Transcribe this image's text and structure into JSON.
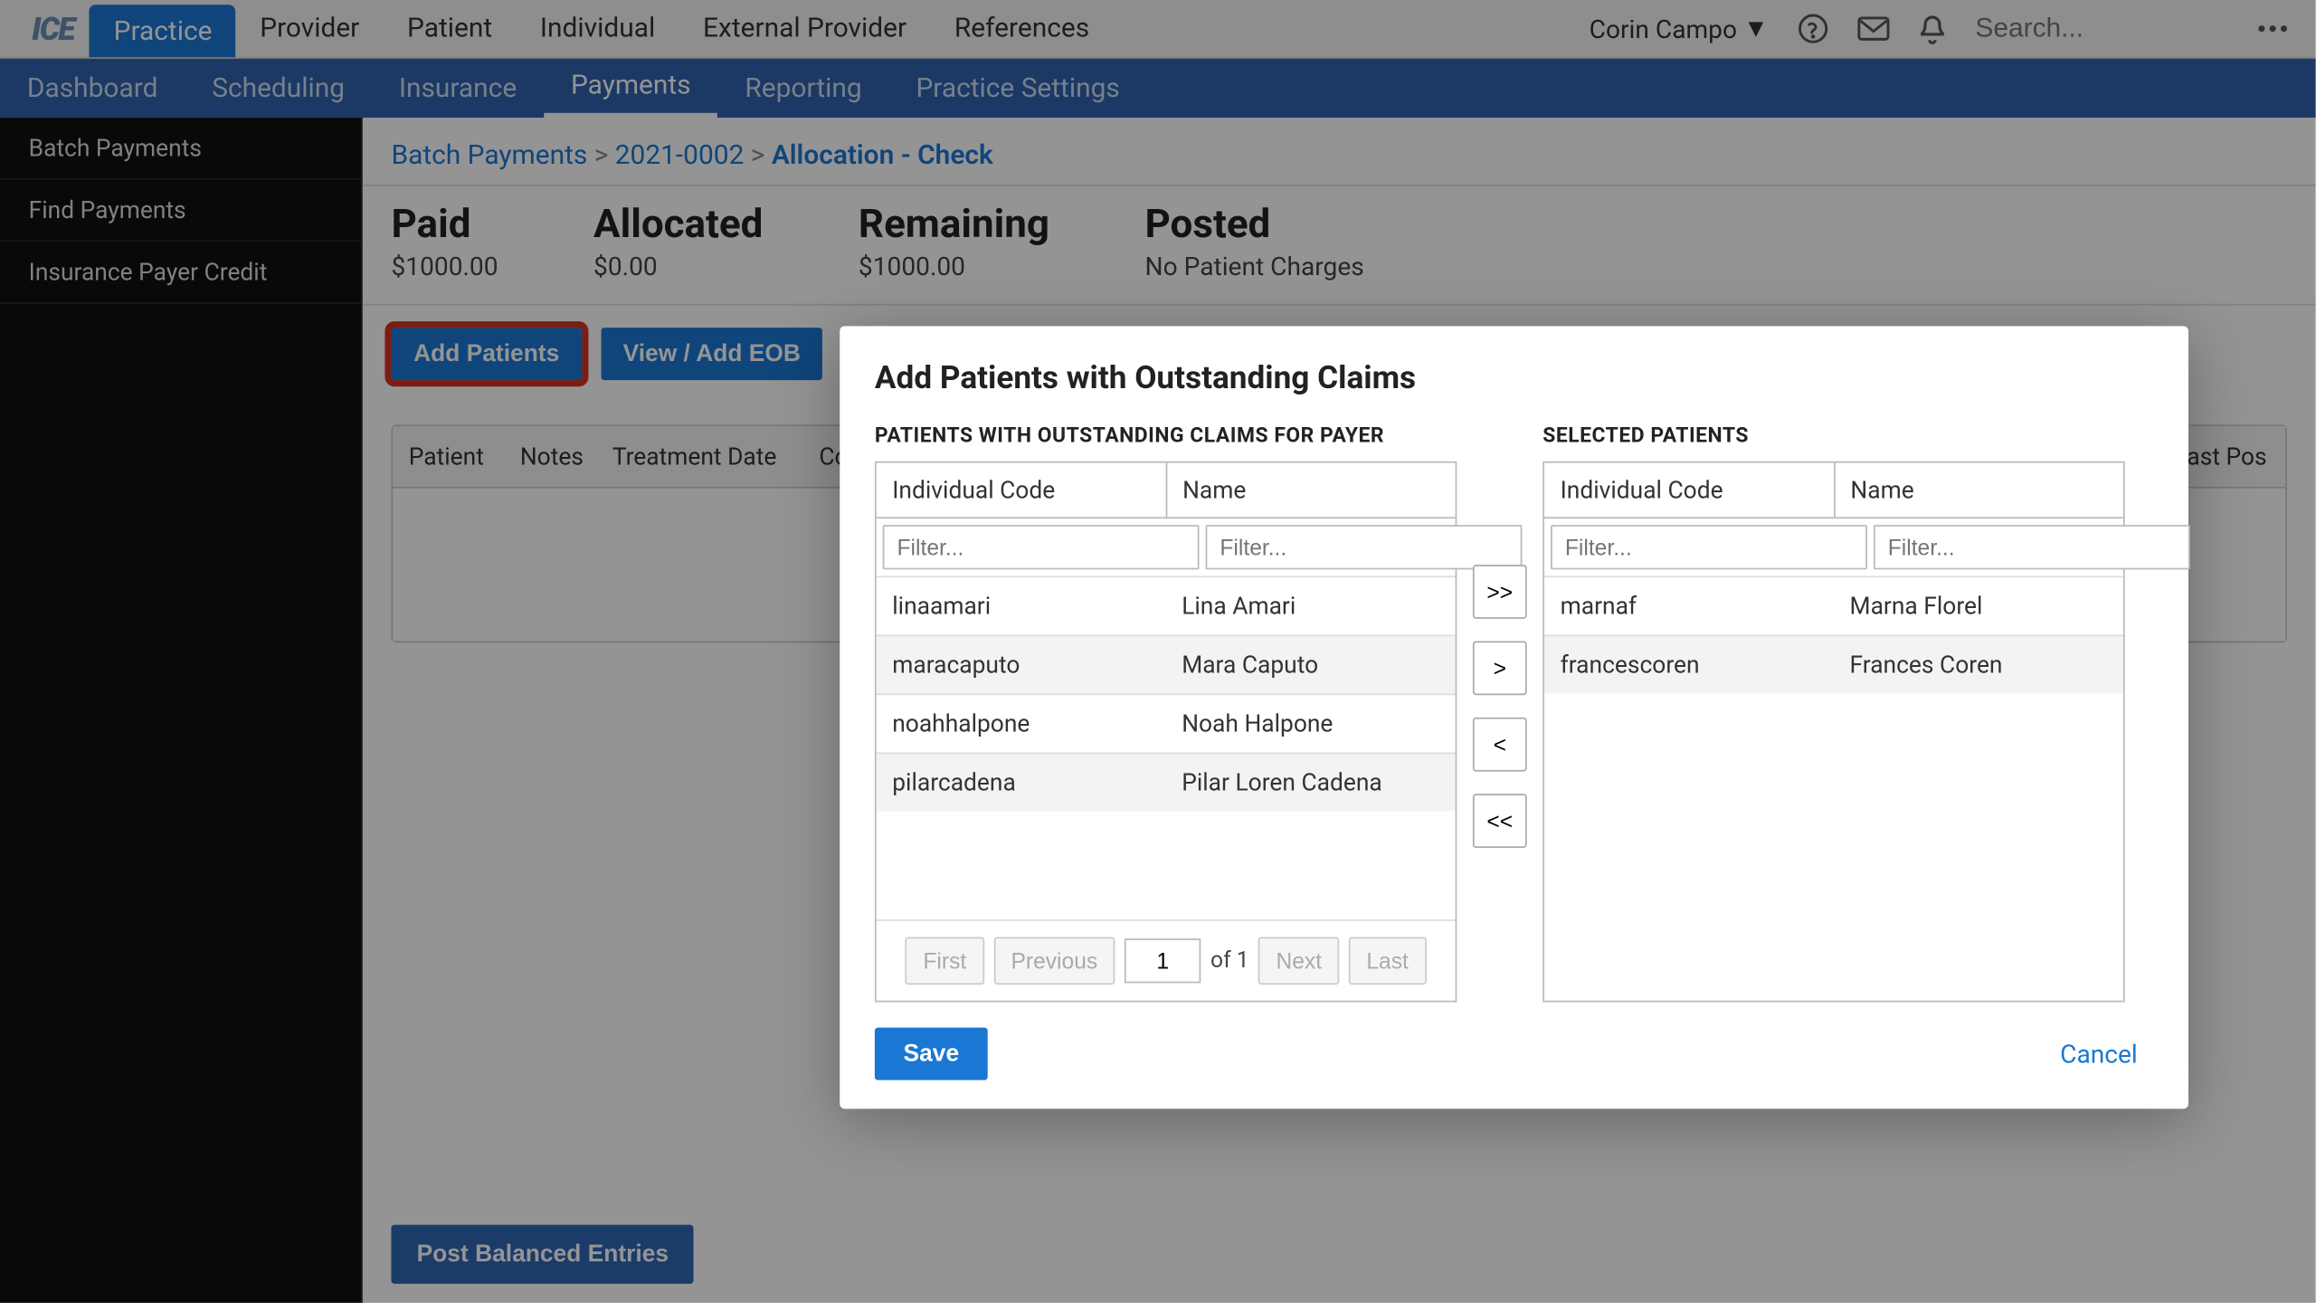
{
  "logo_text": "ICE",
  "topnav": [
    "Practice",
    "Provider",
    "Patient",
    "Individual",
    "External Provider",
    "References"
  ],
  "topnav_active_index": 0,
  "user_name": "Corin Campo",
  "search_placeholder": "Search...",
  "subnav": [
    "Dashboard",
    "Scheduling",
    "Insurance",
    "Payments",
    "Reporting",
    "Practice Settings"
  ],
  "subnav_active_index": 3,
  "sidebar": [
    "Batch Payments",
    "Find Payments",
    "Insurance Payer Credit"
  ],
  "breadcrumb": {
    "root": "Batch Payments",
    "mid": "2021-0002",
    "current": "Allocation - Check"
  },
  "summary": {
    "paid_label": "Paid",
    "paid_value": "$1000.00",
    "allocated_label": "Allocated",
    "allocated_value": "$0.00",
    "remaining_label": "Remaining",
    "remaining_value": "$1000.00",
    "posted_label": "Posted",
    "posted_value": "No Patient Charges"
  },
  "buttons": {
    "add_patients": "Add Patients",
    "view_eob": "View / Add EOB",
    "post_balanced": "Post Balanced Entries"
  },
  "table_columns": [
    "Patient",
    "Notes",
    "Treatment Date",
    "Code",
    "",
    "",
    "",
    "Last Pos"
  ],
  "modal": {
    "title": "Add Patients with Outstanding Claims",
    "left_label": "PATIENTS WITH OUTSTANDING CLAIMS FOR PAYER",
    "right_label": "SELECTED PATIENTS",
    "col_individual": "Individual Code",
    "col_name": "Name",
    "filter_placeholder": "Filter...",
    "available": [
      {
        "code": "linaamari",
        "name": "Lina Amari"
      },
      {
        "code": "maracaputo",
        "name": "Mara Caputo"
      },
      {
        "code": "noahhalpone",
        "name": "Noah Halpone"
      },
      {
        "code": "pilarcadena",
        "name": "Pilar Loren Cadena"
      }
    ],
    "selected": [
      {
        "code": "marnaf",
        "name": "Marna Florel"
      },
      {
        "code": "francescoren",
        "name": "Frances Coren"
      }
    ],
    "move": {
      "all_right": ">>",
      "right": ">",
      "left": "<",
      "all_left": "<<"
    },
    "pager": {
      "first": "First",
      "prev": "Previous",
      "page": "1",
      "of": "of 1",
      "next": "Next",
      "last": "Last"
    },
    "save": "Save",
    "cancel": "Cancel"
  }
}
